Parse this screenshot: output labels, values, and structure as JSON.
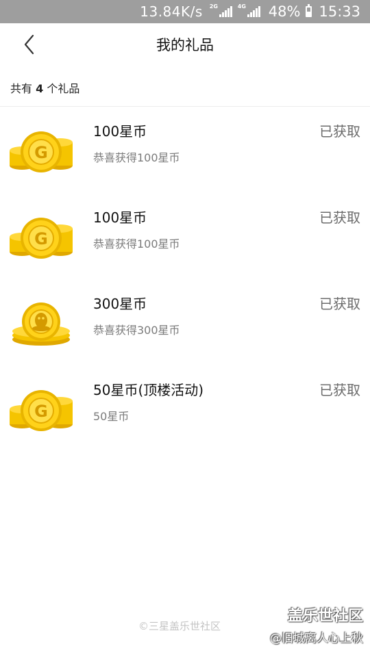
{
  "status_bar": {
    "network_speed": "13.84K/s",
    "sim1_tag": "2G",
    "sim2_tag": "4G",
    "battery": "48%",
    "time": "15:33"
  },
  "header": {
    "back_icon": "chevron-left-icon",
    "title": "我的礼品"
  },
  "summary": {
    "prefix": "共有",
    "count": "4",
    "suffix": "个礼品"
  },
  "gifts": [
    {
      "name": "100星币",
      "desc": "恭喜获得100星币",
      "status": "已获取",
      "icon": "gold-coin-g-icon"
    },
    {
      "name": "100星币",
      "desc": "恭喜获得100星币",
      "status": "已获取",
      "icon": "gold-coin-g-icon"
    },
    {
      "name": "300星币",
      "desc": "恭喜获得300星币",
      "status": "已获取",
      "icon": "gold-coin-penguin-icon"
    },
    {
      "name": "50星币(顶楼活动)",
      "desc": "50星币",
      "status": "已获取",
      "icon": "gold-coin-g-icon"
    }
  ],
  "watermarks": {
    "center": "©三星盖乐世社区",
    "logo": "盖乐世社区",
    "user": "@旧城离人心上秋"
  },
  "colors": {
    "status_bar_bg": "#9e9e9e",
    "coin_gold": "#f5c400",
    "coin_dark": "#e0a800"
  }
}
